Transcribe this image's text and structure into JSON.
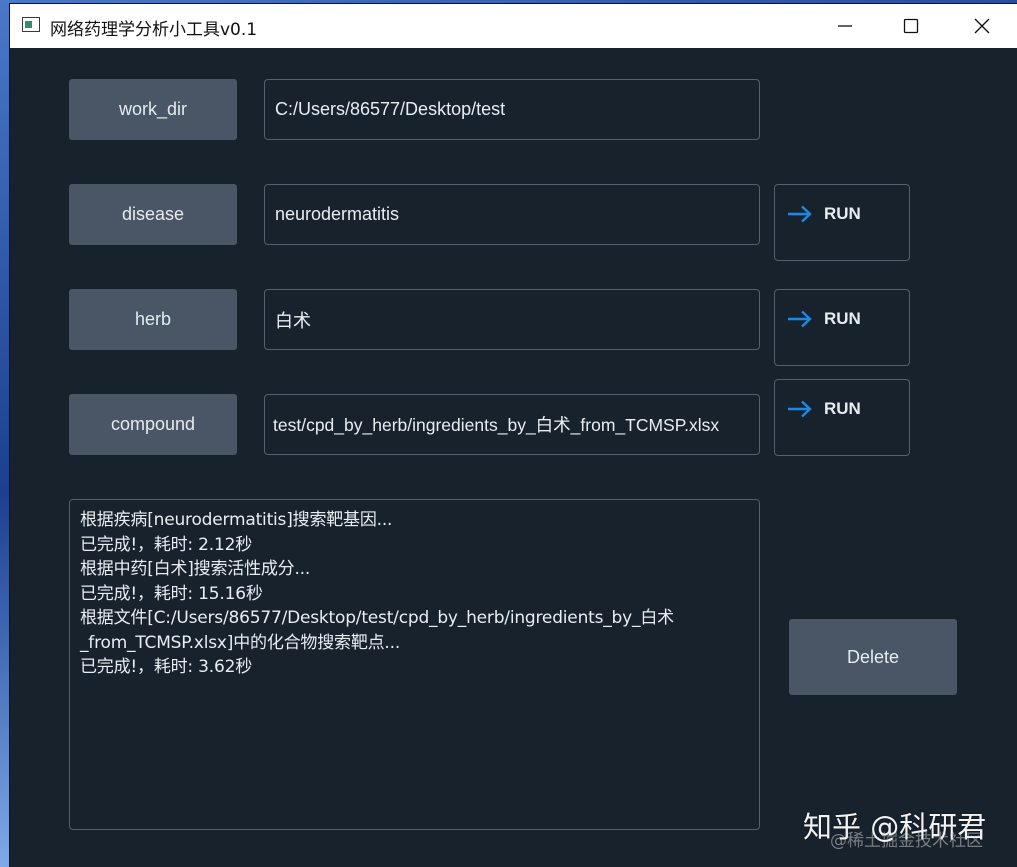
{
  "window": {
    "title": "网络药理学分析小工具v0.1"
  },
  "rows": {
    "work_dir": {
      "label": "work_dir",
      "value": "C:/Users/86577/Desktop/test"
    },
    "disease": {
      "label": "disease",
      "value": "neurodermatitis",
      "run_label": "RUN"
    },
    "herb": {
      "label": "herb",
      "value": "白术",
      "run_label": "RUN"
    },
    "compound": {
      "label": "compound",
      "value": "test/cpd_by_herb/ingredients_by_白术_from_TCMSP.xlsx",
      "run_label": "RUN"
    }
  },
  "log": {
    "lines": [
      "根据疾病[neurodermatitis]搜索靶基因...",
      "已完成!，耗时: 2.12秒",
      "根据中药[白术]搜索活性成分...",
      "已完成!，耗时: 15.16秒",
      "根据文件[C:/Users/86577/Desktop/test/cpd_by_herb/ingredients_by_白术",
      "_from_TCMSP.xlsx]中的化合物搜索靶点...",
      "已完成!，耗时: 3.62秒"
    ]
  },
  "delete_label": "Delete",
  "watermark": {
    "main": "知乎 @科研君",
    "sub": "@稀土掘金技术社区"
  },
  "colors": {
    "background": "#18222d",
    "button": "#4a5666",
    "border": "#56606c",
    "accent_arrow": "#1e88e5"
  },
  "icons": {
    "run": "arrow-right-icon",
    "minimize": "minimize-icon",
    "maximize": "maximize-icon",
    "close": "close-icon"
  }
}
